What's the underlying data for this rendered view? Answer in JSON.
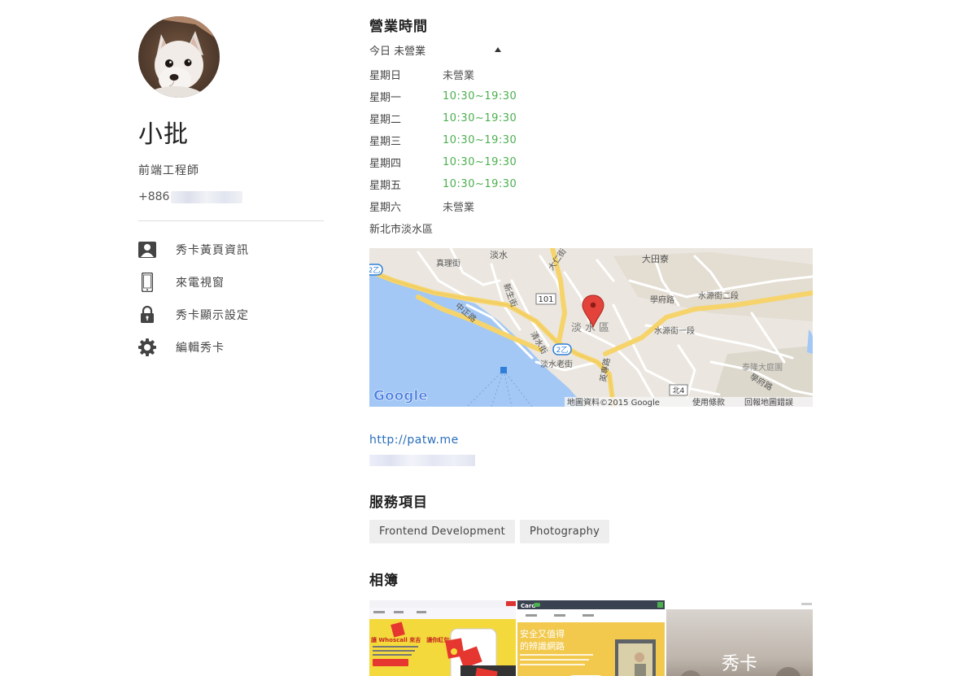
{
  "profile": {
    "name": "小批",
    "title": "前端工程師",
    "phone_prefix": "+886",
    "avatar_icon": "dog-photo"
  },
  "menu": [
    {
      "icon": "contact-card-icon",
      "label": "秀卡黃頁資訊"
    },
    {
      "icon": "phone-icon",
      "label": "來電視窗"
    },
    {
      "icon": "lock-icon",
      "label": "秀卡顯示設定"
    },
    {
      "icon": "gear-icon",
      "label": "編輯秀卡"
    }
  ],
  "hours": {
    "heading": "營業時間",
    "today_label": "今日",
    "today_status": "未營業",
    "rows": [
      {
        "day": "星期日",
        "time": "未營業"
      },
      {
        "day": "星期一",
        "time": "10:30~19:30"
      },
      {
        "day": "星期二",
        "time": "10:30~19:30"
      },
      {
        "day": "星期三",
        "time": "10:30~19:30"
      },
      {
        "day": "星期四",
        "time": "10:30~19:30"
      },
      {
        "day": "星期五",
        "time": "10:30~19:30"
      },
      {
        "day": "星期六",
        "time": "未營業"
      }
    ]
  },
  "address": "新北市淡水區",
  "map": {
    "labels": {
      "danshui_top": "淡水",
      "datian": "大田寮",
      "dazhong": "大仁街",
      "zhenli": "真理街",
      "zhongshan": "中正路",
      "xinsheng": "新生街",
      "qingshui": "清水街",
      "laojie": "淡水老街",
      "xuefu": "學府路",
      "shuiyuan2": "水源街二段",
      "shuiyuan1": "水源街一段",
      "danshui_district": "淡水區",
      "taifu": "泰隆大庭園",
      "yingzhuan": "英專路",
      "xueyuan": "學府路",
      "road101": "101",
      "road2a": "2乙",
      "road2b": "2乙",
      "roadN4": "北4",
      "google": "Google",
      "copyright": "地圖資料©2015 Google",
      "terms": "使用條款",
      "report": "回報地圖錯誤"
    },
    "colors": {
      "land": "#ebe7e0",
      "water": "#a3c8f5",
      "major_road": "#f6d46b",
      "minor_road": "#ffffff",
      "marker": "#e3433a"
    }
  },
  "website": "http://patw.me",
  "services": {
    "heading": "服務項目",
    "tags": [
      "Frontend Development",
      "Photography"
    ]
  },
  "album": {
    "heading": "相簿",
    "thumb1_headline": "讓 Whoscall 來吉　讓你紅包大大發",
    "thumb2_app": "Card",
    "thumb2_headline_1": "安全又值得",
    "thumb2_headline_2": "的辨識網路",
    "thumb3_title": "秀卡"
  }
}
